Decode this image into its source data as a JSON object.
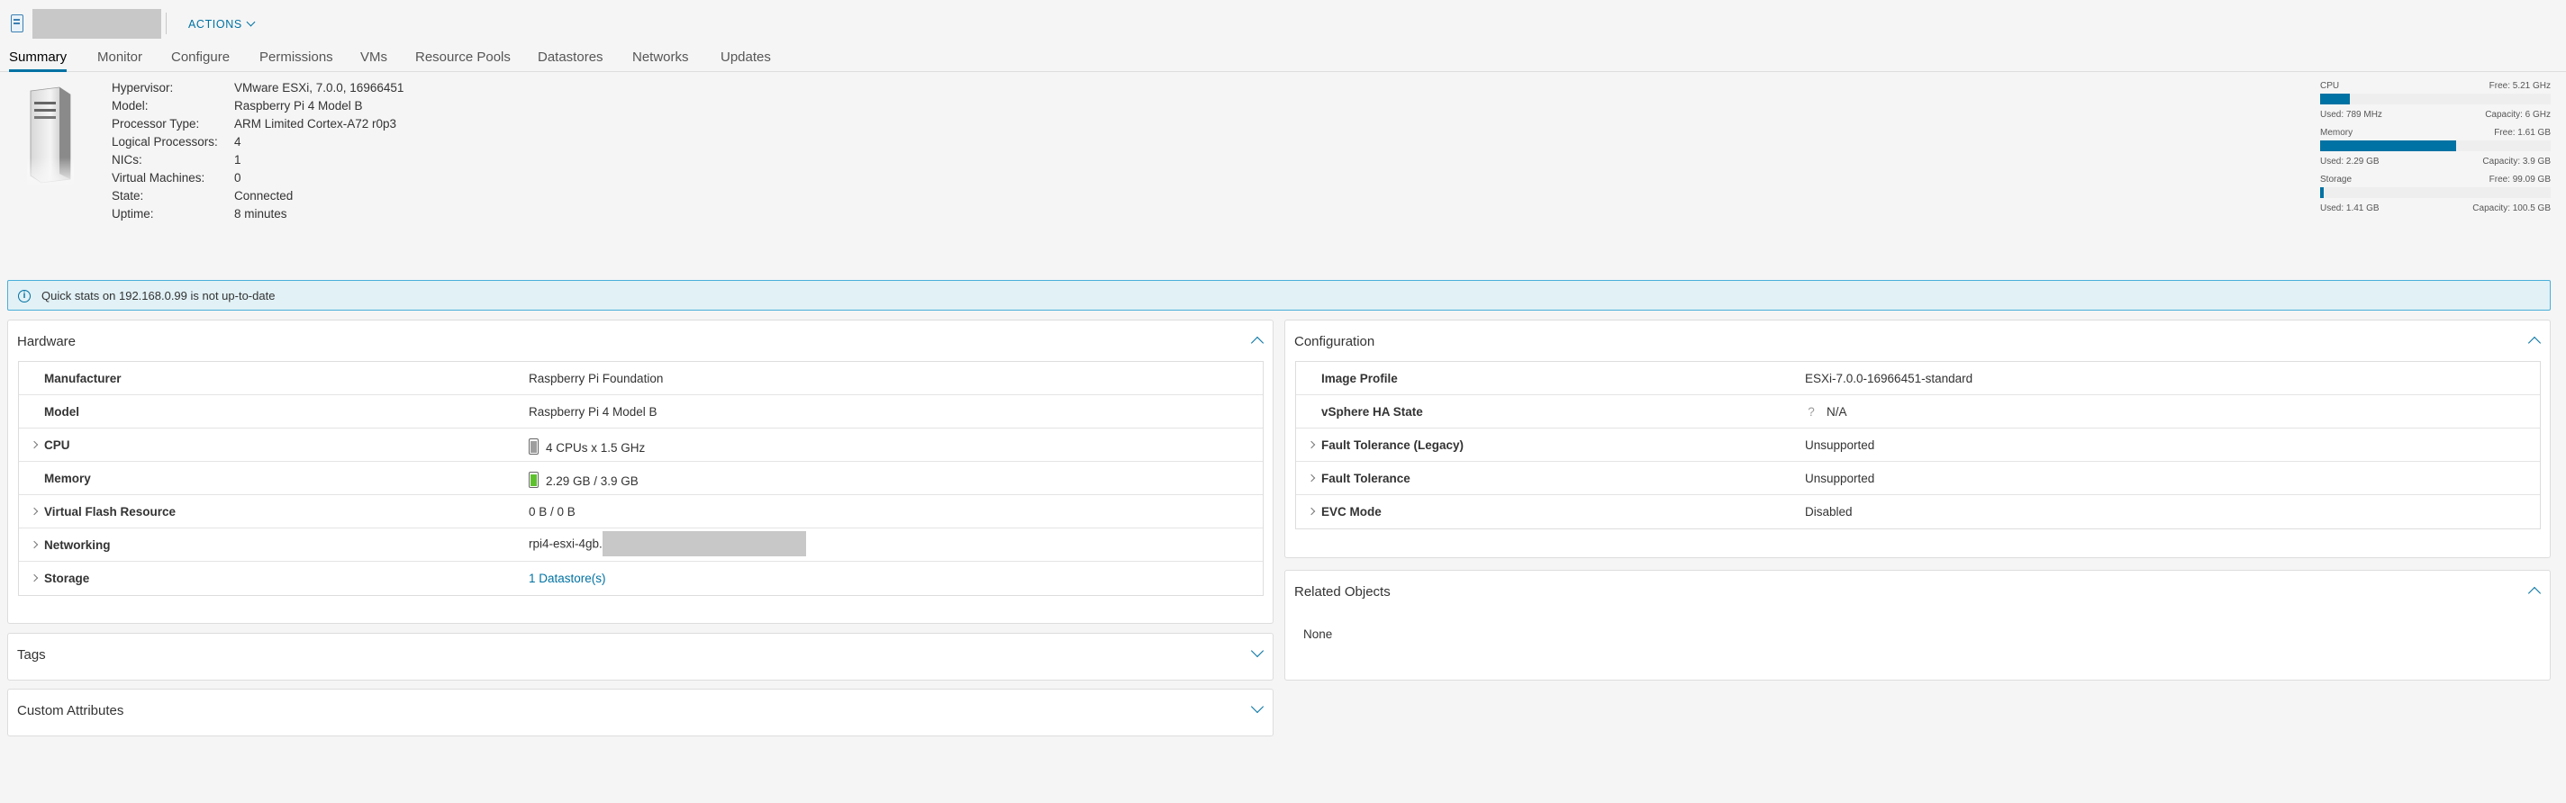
{
  "header": {
    "actions_label": "ACTIONS"
  },
  "tabs": [
    {
      "label": "Summary"
    },
    {
      "label": "Monitor"
    },
    {
      "label": "Configure"
    },
    {
      "label": "Permissions"
    },
    {
      "label": "VMs"
    },
    {
      "label": "Resource Pools"
    },
    {
      "label": "Datastores"
    },
    {
      "label": "Networks"
    },
    {
      "label": "Updates"
    }
  ],
  "summary": {
    "props": [
      {
        "k": "Hypervisor:",
        "v": "VMware ESXi, 7.0.0, 16966451"
      },
      {
        "k": "Model:",
        "v": "Raspberry Pi 4 Model B"
      },
      {
        "k": "Processor Type:",
        "v": "ARM Limited Cortex-A72 r0p3"
      },
      {
        "k": "Logical Processors:",
        "v": "4"
      },
      {
        "k": "NICs:",
        "v": "1"
      },
      {
        "k": "Virtual Machines:",
        "v": "0"
      },
      {
        "k": "State:",
        "v": "Connected"
      },
      {
        "k": "Uptime:",
        "v": "8 minutes"
      }
    ]
  },
  "stats": [
    {
      "name": "CPU",
      "free": "Free: 5.21 GHz",
      "used": "Used: 789 MHz",
      "cap": "Capacity: 6 GHz",
      "fraction": 0.13
    },
    {
      "name": "Memory",
      "free": "Free: 1.61 GB",
      "used": "Used: 2.29 GB",
      "cap": "Capacity: 3.9 GB",
      "fraction": 0.59
    },
    {
      "name": "Storage",
      "free": "Free: 99.09 GB",
      "used": "Used: 1.41 GB",
      "cap": "Capacity: 100.5 GB",
      "fraction": 0.014
    }
  ],
  "alert": {
    "message": "Quick stats on 192.168.0.99 is not up-to-date"
  },
  "hardware": {
    "title": "Hardware",
    "rows": [
      {
        "label": "Manufacturer",
        "value": "Raspberry Pi Foundation"
      },
      {
        "label": "Model",
        "value": "Raspberry Pi 4 Model B"
      },
      {
        "label": "CPU",
        "value": "4 CPUs x 1.5 GHz"
      },
      {
        "label": "Memory",
        "value": "2.29 GB / 3.9 GB"
      },
      {
        "label": "Virtual Flash Resource",
        "value": "0 B / 0 B"
      },
      {
        "label": "Networking",
        "value": "rpi4-esxi-4gb."
      },
      {
        "label": "Storage",
        "value": "1 Datastore(s)"
      }
    ]
  },
  "tags": {
    "title": "Tags"
  },
  "custom_attributes": {
    "title": "Custom Attributes"
  },
  "configuration": {
    "title": "Configuration",
    "rows": [
      {
        "label": "Image Profile",
        "value": "ESXi-7.0.0-16966451-standard"
      },
      {
        "label": "vSphere HA State",
        "value": "N/A",
        "icon": "?"
      },
      {
        "label": "Fault Tolerance (Legacy)",
        "value": "Unsupported"
      },
      {
        "label": "Fault Tolerance",
        "value": "Unsupported"
      },
      {
        "label": "EVC Mode",
        "value": "Disabled"
      }
    ]
  },
  "related": {
    "title": "Related Objects",
    "none": "None"
  },
  "colors": {
    "accent": "#0072a3",
    "cpu_battery": "#9e9e9e",
    "memory_battery": "#5dc12e"
  }
}
